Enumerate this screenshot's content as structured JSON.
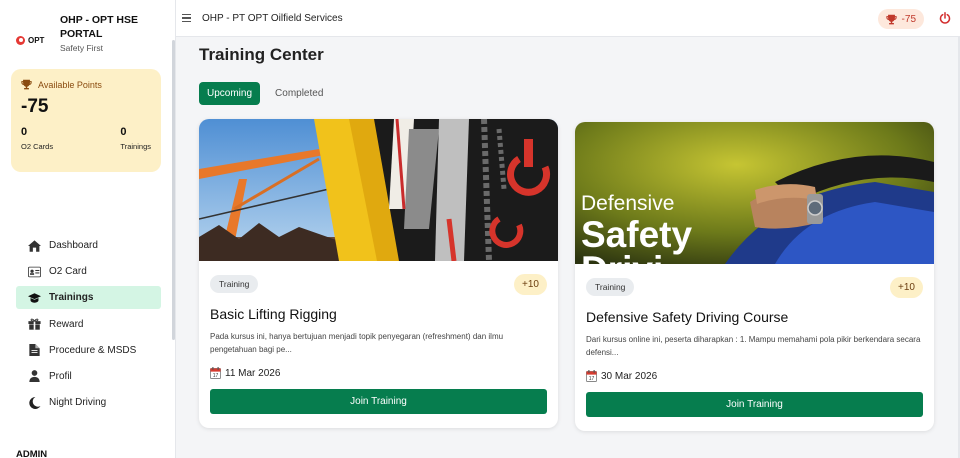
{
  "brand": {
    "logo_text": "OPT",
    "title": "OHP - OPT HSE PORTAL",
    "subtitle": "Safety First"
  },
  "points_card": {
    "label": "Available Points",
    "value": "-75",
    "stats": [
      {
        "value": "0",
        "label": "O2 Cards"
      },
      {
        "value": "0",
        "label": "Trainings"
      }
    ]
  },
  "nav": {
    "items": [
      {
        "label": "Dashboard",
        "icon": "home-icon"
      },
      {
        "label": "O2 Card",
        "icon": "id-card-icon"
      },
      {
        "label": "Trainings",
        "icon": "graduation-cap-icon",
        "active": true
      },
      {
        "label": "Reward",
        "icon": "gift-icon"
      },
      {
        "label": "Procedure & MSDS",
        "icon": "file-icon"
      },
      {
        "label": "Profil",
        "icon": "user-icon"
      },
      {
        "label": "Night Driving",
        "icon": "moon-icon"
      }
    ],
    "section_label": "ADMIN"
  },
  "topbar": {
    "title": "OHP - PT OPT Oilfield Services",
    "points": "-75"
  },
  "page": {
    "title": "Training Center",
    "tabs": [
      {
        "label": "Upcoming",
        "active": true
      },
      {
        "label": "Completed",
        "active": false
      }
    ]
  },
  "trainings": [
    {
      "badge": "Training",
      "points": "+10",
      "title": "Basic Lifting Rigging",
      "description": "Pada kursus ini, hanya bertujuan menjadi topik penyegaran (refreshment) dan ilmu pengetahuan bagi pe...",
      "date": "11 Mar 2026",
      "button": "Join Training"
    },
    {
      "badge": "Training",
      "points": "+10",
      "title": "Defensive Safety Driving Course",
      "description": "Dari kursus online ini, peserta diharapkan : 1. Mampu memahami pola pikir berkendara secara defensi...",
      "date": "30 Mar 2026",
      "button": "Join Training",
      "image_text_1": "Defensive",
      "image_text_2": "Safety",
      "image_text_3": "Drivi"
    }
  ],
  "colors": {
    "primary": "#067d4e",
    "active_nav_bg": "#d4f5e4",
    "points_card_bg": "#fdf0c7",
    "danger": "#c0392b"
  }
}
